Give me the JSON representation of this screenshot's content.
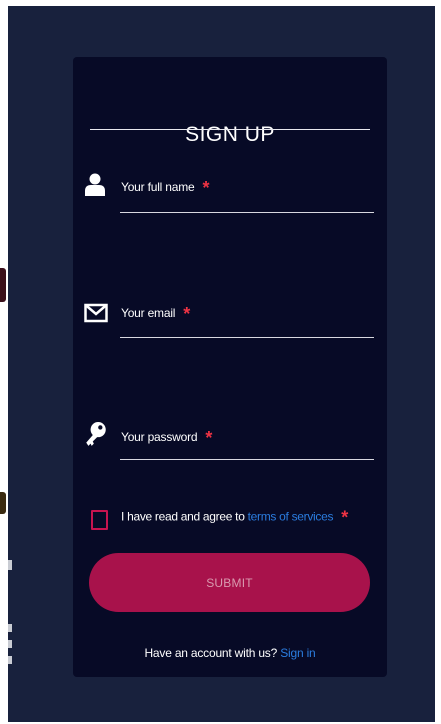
{
  "form": {
    "title": "SIGN UP",
    "fields": [
      {
        "label": "Your full name",
        "required_mark": "*",
        "icon": "user-icon"
      },
      {
        "label": "Your email",
        "required_mark": "*",
        "icon": "envelope-icon"
      },
      {
        "label": "Your password",
        "required_mark": "*",
        "icon": "key-icon"
      }
    ],
    "agree": {
      "text": "I have read and agree to ",
      "link": "terms of services",
      "required_mark": "*",
      "checked": false
    },
    "submit_label": "SUBMIT",
    "signin": {
      "text": "Have an account with us? ",
      "link": "Sign in"
    }
  },
  "colors": {
    "backdrop": "#18213d",
    "card": "#070a26",
    "accent": "#a8124b",
    "link": "#2b7de0",
    "required": "#ee3344"
  }
}
